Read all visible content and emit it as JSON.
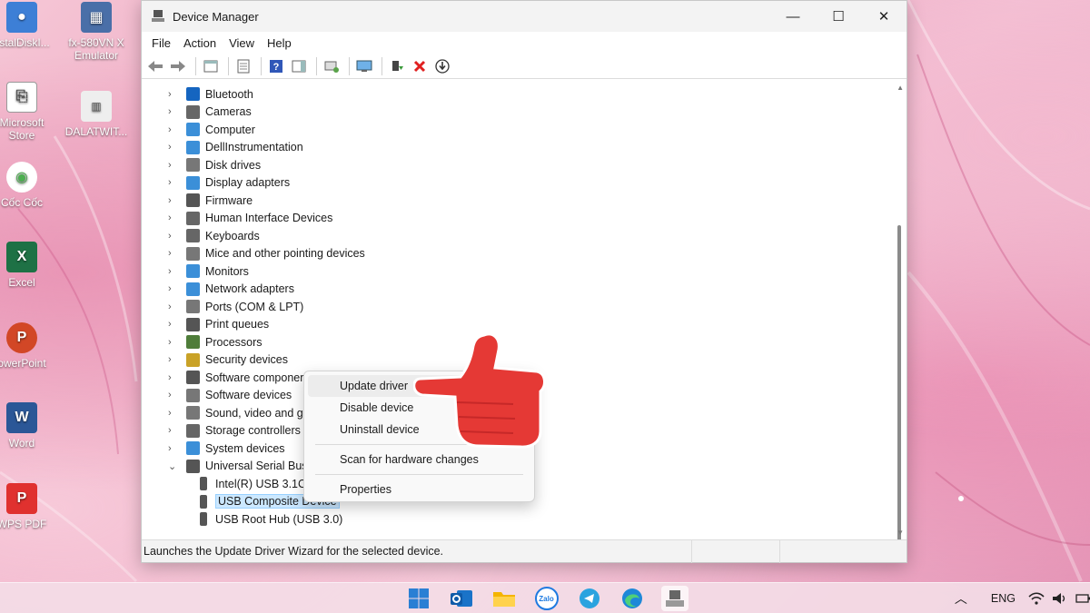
{
  "desktop": {
    "icons": [
      {
        "label": "ystalDiskI...",
        "color": "#3d7fd6"
      },
      {
        "label": "fx-580VN X Emulator",
        "color": "#4a6fa8"
      },
      {
        "label": "Microsoft Store",
        "color": "#e8e8e8"
      },
      {
        "label": "DALATWIT...",
        "color": "#d0d0d0"
      },
      {
        "label": "Cốc Cốc",
        "color": "#4caf50"
      },
      {
        "label": "Excel",
        "color": "#1e7145"
      },
      {
        "label": "owerPoint",
        "color": "#d24726"
      },
      {
        "label": "Word",
        "color": "#2b5797"
      },
      {
        "label": "WPS PDF",
        "color": "#e0312f"
      }
    ]
  },
  "window": {
    "title": "Device Manager",
    "controls": {
      "minimize": "—",
      "maximize": "☐",
      "close": "✕"
    },
    "menu": [
      "File",
      "Action",
      "View",
      "Help"
    ],
    "tree": [
      {
        "label": "Bluetooth",
        "icon": "bluetooth-icon",
        "color": "#1565c0"
      },
      {
        "label": "Cameras",
        "icon": "camera-icon",
        "color": "#666666"
      },
      {
        "label": "Computer",
        "icon": "computer-icon",
        "color": "#3b8fd8"
      },
      {
        "label": "DellInstrumentation",
        "icon": "device-icon",
        "color": "#3b8fd8"
      },
      {
        "label": "Disk drives",
        "icon": "disk-icon",
        "color": "#777777"
      },
      {
        "label": "Display adapters",
        "icon": "display-adapter-icon",
        "color": "#3b8fd8"
      },
      {
        "label": "Firmware",
        "icon": "firmware-icon",
        "color": "#555555"
      },
      {
        "label": "Human Interface Devices",
        "icon": "hid-icon",
        "color": "#666666"
      },
      {
        "label": "Keyboards",
        "icon": "keyboard-icon",
        "color": "#666666"
      },
      {
        "label": "Mice and other pointing devices",
        "icon": "mouse-icon",
        "color": "#777777"
      },
      {
        "label": "Monitors",
        "icon": "monitor-icon",
        "color": "#3b8fd8"
      },
      {
        "label": "Network adapters",
        "icon": "network-icon",
        "color": "#3b8fd8"
      },
      {
        "label": "Ports (COM & LPT)",
        "icon": "port-icon",
        "color": "#777777"
      },
      {
        "label": "Print queues",
        "icon": "printer-icon",
        "color": "#555555"
      },
      {
        "label": "Processors",
        "icon": "processor-icon",
        "color": "#4f7d3a"
      },
      {
        "label": "Security devices",
        "icon": "security-icon",
        "color": "#c9a227"
      },
      {
        "label": "Software componer",
        "icon": "software-component-icon",
        "color": "#555555"
      },
      {
        "label": "Software devices",
        "icon": "software-device-icon",
        "color": "#777777"
      },
      {
        "label": "Sound, video and g",
        "icon": "sound-icon",
        "color": "#777777"
      },
      {
        "label": "Storage controllers",
        "icon": "storage-icon",
        "color": "#666666"
      },
      {
        "label": "System devices",
        "icon": "system-icon",
        "color": "#3b8fd8"
      },
      {
        "label": "Universal Serial Bus",
        "icon": "usb-icon",
        "color": "#555555",
        "expanded": true
      }
    ],
    "usb_children": [
      {
        "label": "Intel(R) USB 3.1C"
      },
      {
        "label": "USB Composite Device",
        "selected": true
      },
      {
        "label": "USB Root Hub (USB 3.0)"
      }
    ],
    "status_text": "Launches the Update Driver Wizard for the selected device."
  },
  "context_menu": {
    "items": [
      "Update driver",
      "Disable device",
      "Uninstall device",
      "Scan for hardware changes",
      "Properties"
    ]
  },
  "taskbar": {
    "apps": [
      "windows-start",
      "outlook",
      "file-explorer",
      "zalo",
      "telegram",
      "edge",
      "device-manager"
    ],
    "zalo_label": "Zalo",
    "lang": "ENG"
  },
  "colors": {
    "accent_red": "#e53935",
    "selection": "#cce8ff"
  }
}
